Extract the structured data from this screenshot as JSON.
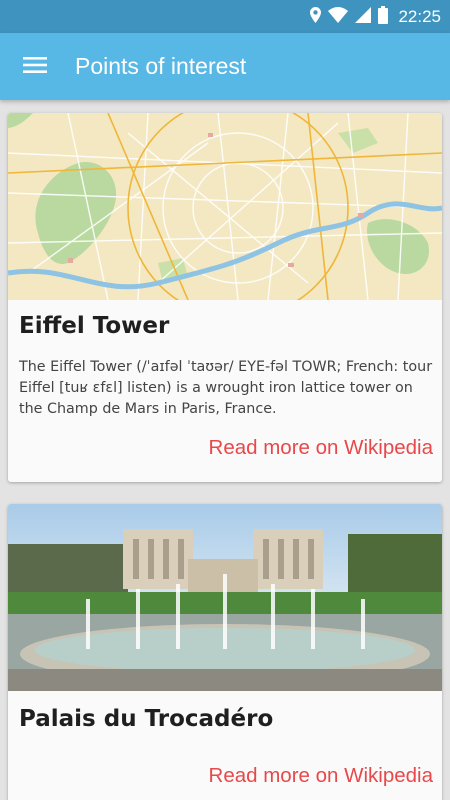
{
  "status_bar": {
    "time": "22:25",
    "icons": [
      "location-icon",
      "wifi-icon",
      "signal-icon",
      "battery-icon"
    ]
  },
  "app_bar": {
    "title": "Points of interest",
    "menu_icon": "hamburger-menu-icon"
  },
  "colors": {
    "status_bar": "#3e93bf",
    "app_bar": "#57b7e5",
    "link": "#e8484a",
    "background": "#e3e3e3",
    "card": "#fafafa"
  },
  "cards": [
    {
      "image": "map-of-paris-image",
      "title": "Eiffel Tower",
      "description": "The Eiffel Tower (/ˈaɪfəl ˈtaʊər/ EYE-fəl TOWR; French: tour Eiffel [tuʁ ɛfɛl] listen) is a wrought iron lattice tower on the Champ de Mars in Paris, France.",
      "link": "Read more on Wikipedia"
    },
    {
      "image": "palais-du-trocadero-photo",
      "title": "Palais du Trocadéro",
      "link": "Read more on Wikipedia"
    }
  ]
}
